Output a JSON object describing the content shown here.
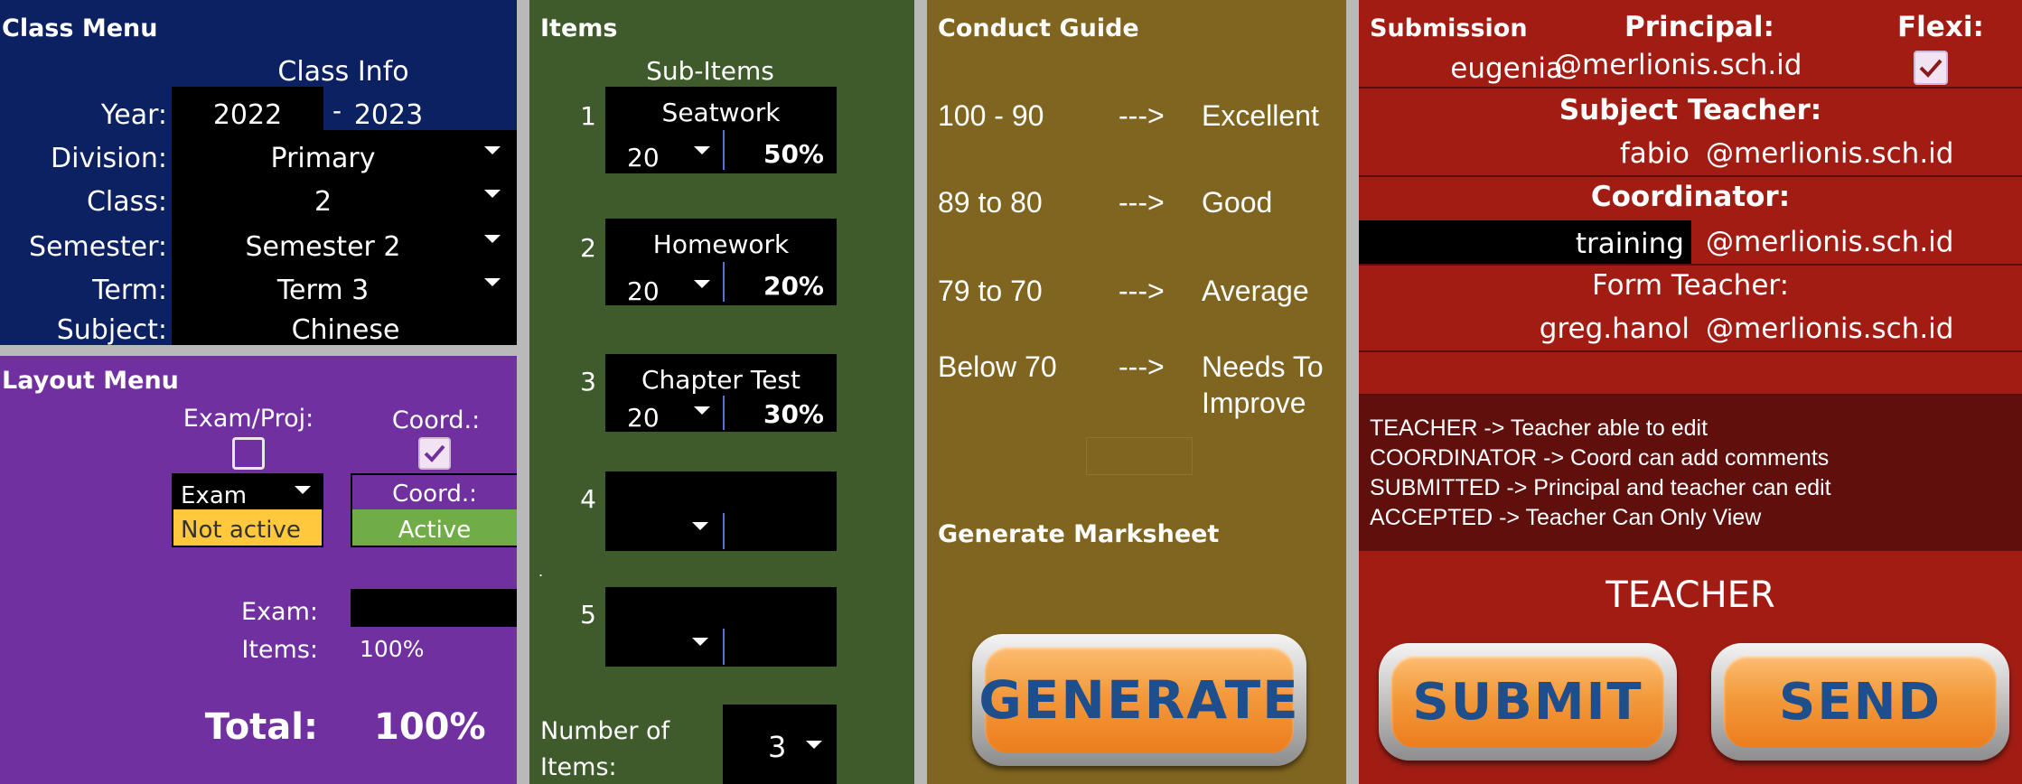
{
  "class_menu": {
    "title": "Class Menu",
    "section_header": "Class Info",
    "year_label": "Year:",
    "year_start": "2022",
    "year_sep": "-",
    "year_end": "2023",
    "division_label": "Division:",
    "division_value": "Primary",
    "class_label": "Class:",
    "class_value": "2",
    "semester_label": "Semester:",
    "semester_value": "Semester 2",
    "term_label": "Term:",
    "term_value": "Term 3",
    "subject_label": "Subject:",
    "subject_value": "Chinese"
  },
  "layout_menu": {
    "title": "Layout Menu",
    "exam_proj_label": "Exam/Proj:",
    "exam_proj_checked": false,
    "coord_label": "Coord.:",
    "coord_checked": true,
    "exam_select_value": "Exam",
    "exam_status": "Not active",
    "coord_select_value": "Coord.:",
    "coord_status": "Active",
    "exam_weight_label": "Exam:",
    "exam_weight_value": "",
    "items_weight_label": "Items:",
    "items_weight_value": "100%",
    "total_label": "Total:",
    "total_value": "100%"
  },
  "items": {
    "title": "Items",
    "header": "Sub-Items",
    "list": [
      {
        "num": "1",
        "name": "Seatwork",
        "count": "20",
        "pct": "50%"
      },
      {
        "num": "2",
        "name": "Homework",
        "count": "20",
        "pct": "20%"
      },
      {
        "num": "3",
        "name": "Chapter Test",
        "count": "20",
        "pct": "30%"
      },
      {
        "num": "4",
        "name": "",
        "count": "",
        "pct": ""
      },
      {
        "num": "5",
        "name": "",
        "count": "",
        "pct": ""
      }
    ],
    "dot": ".",
    "number_label_1": "Number of",
    "number_label_2": "Items:",
    "number_value": "3"
  },
  "conduct": {
    "title": "Conduct Guide",
    "rows": [
      {
        "range": "100 - 90",
        "arrow": "--->",
        "grade": "Excellent",
        "grade2": ""
      },
      {
        "range": "89 to 80",
        "arrow": "--->",
        "grade": "Good",
        "grade2": ""
      },
      {
        "range": "79 to 70",
        "arrow": "--->",
        "grade": "Average",
        "grade2": ""
      },
      {
        "range": "Below 70",
        "arrow": "--->",
        "grade": "Needs To",
        "grade2": "Improve"
      }
    ],
    "generate_header": "Generate Marksheet",
    "generate_button": "GENERATE"
  },
  "submission": {
    "title": "Submission",
    "principal_label": "Principal:",
    "flexi_label": "Flexi:",
    "flexi_checked": true,
    "principal_user": "eugenia",
    "principal_domain": "@merlionis.sch.id",
    "subject_teacher_label": "Subject Teacher:",
    "subject_teacher_user": "fabio",
    "subject_teacher_domain": "@merlionis.sch.id",
    "coordinator_label": "Coordinator:",
    "coordinator_user": "training",
    "coordinator_domain": "@merlionis.sch.id",
    "form_teacher_label": "Form Teacher:",
    "form_teacher_user": "greg.hanol",
    "form_teacher_domain": "@merlionis.sch.id",
    "legend": [
      "TEACHER -> Teacher able to edit",
      "COORDINATOR -> Coord can add comments",
      "SUBMITTED -> Principal and teacher can edit",
      "ACCEPTED -> Teacher Can Only View"
    ],
    "status": "TEACHER",
    "submit_button": "SUBMIT",
    "send_button": "SEND"
  },
  "colors": {
    "class_menu_bg": "#0c2161",
    "layout_menu_bg": "#7030a0",
    "items_bg": "#3f5b2c",
    "conduct_bg": "#806520",
    "submission_bg": "#a11d14",
    "legend_bg": "#5f0f0c",
    "not_active": "#ffc83d",
    "active": "#70ad47",
    "button_text": "#1f4e8c",
    "button_orange": "#f39a3c"
  }
}
